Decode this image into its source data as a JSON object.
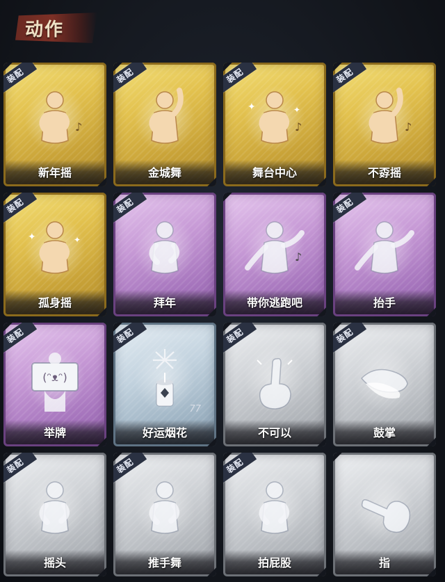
{
  "header": {
    "title": "动作"
  },
  "equip_badge": "装配",
  "cards": [
    {
      "label": "新年摇",
      "tier": "gold",
      "equipped": true,
      "icon": "new-year-shake-icon"
    },
    {
      "label": "金城舞",
      "tier": "gold",
      "equipped": true,
      "icon": "golden-city-dance-icon"
    },
    {
      "label": "舞台中心",
      "tier": "gold",
      "equipped": true,
      "icon": "stage-center-icon"
    },
    {
      "label": "不孬摇",
      "tier": "gold",
      "equipped": true,
      "icon": "not-bad-shake-icon"
    },
    {
      "label": "孤身摇",
      "tier": "gold",
      "equipped": true,
      "icon": "solo-shake-icon"
    },
    {
      "label": "拜年",
      "tier": "purple",
      "equipped": true,
      "icon": "new-year-greeting-icon"
    },
    {
      "label": "带你逃跑吧",
      "tier": "purple",
      "equipped": false,
      "icon": "run-away-icon"
    },
    {
      "label": "抬手",
      "tier": "purple",
      "equipped": true,
      "icon": "raise-hand-icon"
    },
    {
      "label": "举牌",
      "tier": "purple",
      "equipped": true,
      "icon": "hold-sign-icon"
    },
    {
      "label": "好运烟花",
      "tier": "blue",
      "equipped": true,
      "icon": "lucky-firework-icon",
      "count": "77"
    },
    {
      "label": "不可以",
      "tier": "gray",
      "equipped": true,
      "icon": "no-finger-icon"
    },
    {
      "label": "鼓掌",
      "tier": "gray",
      "equipped": true,
      "icon": "clap-icon"
    },
    {
      "label": "摇头",
      "tier": "gray",
      "equipped": true,
      "icon": "shake-head-icon"
    },
    {
      "label": "推手舞",
      "tier": "gray",
      "equipped": true,
      "icon": "push-hand-dance-icon"
    },
    {
      "label": "拍屁股",
      "tier": "gray",
      "equipped": true,
      "icon": "pat-butt-icon"
    },
    {
      "label": "指",
      "tier": "gray",
      "equipped": false,
      "icon": "point-icon"
    }
  ],
  "colors": {
    "gold": "#e3c24f",
    "purple": "#c79ad6",
    "blue": "#c3d3df",
    "gray": "#d0d3d7",
    "figure_gold": "#f4d8b0",
    "figure_light": "#f3f5f8",
    "title_banner": "#7d3026"
  }
}
